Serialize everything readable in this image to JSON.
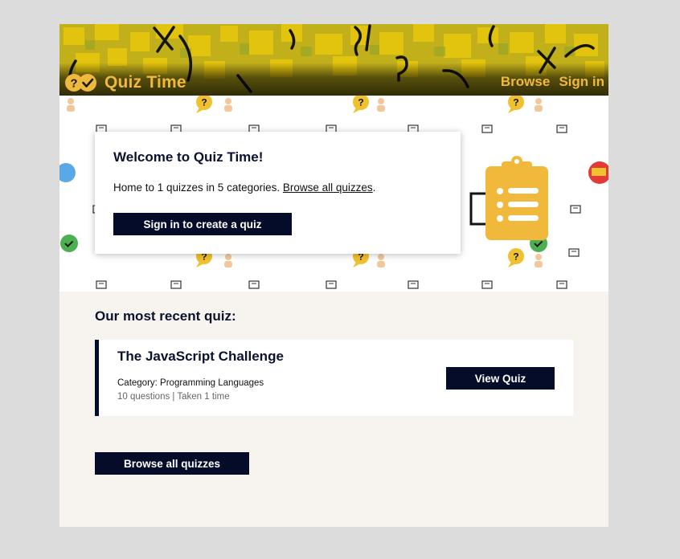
{
  "header": {
    "app_name": "Quiz Time",
    "logo_icon": "question-check-logo-icon",
    "nav": [
      {
        "label": "Browse"
      },
      {
        "label": "Sign in"
      }
    ]
  },
  "hero": {
    "welcome_title": "Welcome to Quiz Time!",
    "summary_text": "Home to 1 quizzes in 5 categories.",
    "browse_link_label": "Browse all quizzes",
    "summary_suffix": ".",
    "signin_button_label": "Sign in to create a quiz",
    "illustration_icon": "clipboard-checklist-icon"
  },
  "recent": {
    "section_title": "Our most recent quiz:",
    "quiz": {
      "title": "The JavaScript Challenge",
      "category": "Category: Programming Languages",
      "stats": "10 questions | Taken 1 time",
      "view_button_label": "View Quiz"
    }
  },
  "footer": {
    "browse_all_label": "Browse all quizzes"
  },
  "colors": {
    "accent": "#efb93c",
    "dark": "#050c2a",
    "page_bg": "#f7f3ef"
  }
}
